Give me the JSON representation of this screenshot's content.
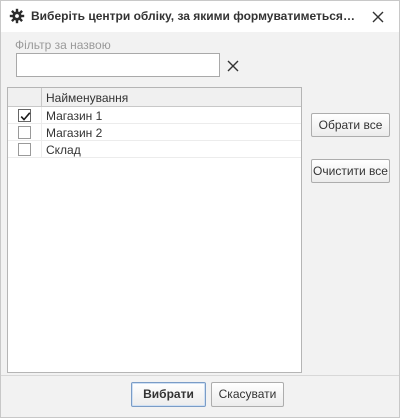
{
  "dialog": {
    "title": "Виберіть центри обліку, за якими формуватиметься р...",
    "title_icon": "gear-icon",
    "close_icon": "close-icon"
  },
  "filter": {
    "label": "Фільтр за назвою",
    "value": "",
    "placeholder": "",
    "clear_icon": "close-icon"
  },
  "list": {
    "column_header": "Найменування",
    "rows": [
      {
        "name": "Магазин 1",
        "checked": true
      },
      {
        "name": "Магазин 2",
        "checked": false
      },
      {
        "name": "Склад",
        "checked": false
      }
    ]
  },
  "side_buttons": {
    "select_all": "Обрати все",
    "clear_all": "Очистити все"
  },
  "footer": {
    "choose": "Вибрати",
    "cancel": "Скасувати"
  }
}
